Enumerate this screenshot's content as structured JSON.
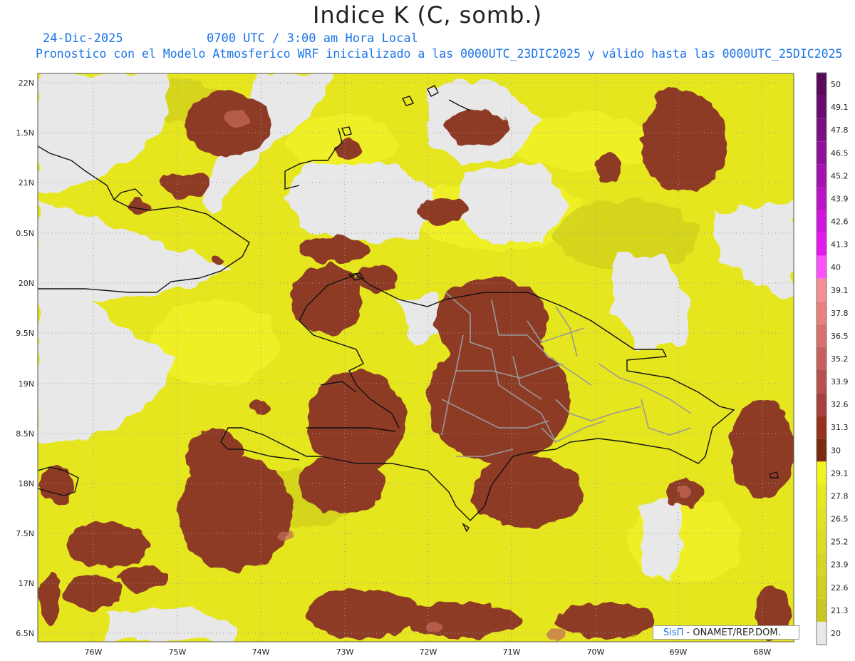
{
  "header": {
    "title": "Indice K (C, somb.)",
    "date": "24-Dic-2025",
    "time": "0700 UTC / 3:00 am Hora Local",
    "description": "Pronostico con el Modelo Atmosferico WRF inicializado a las 0000UTC_23DIC2025 y válido hasta las  0000UTC_25DIC2025"
  },
  "map": {
    "lat_labels": [
      "22N",
      "1.5N",
      "21N",
      "0.5N",
      "20N",
      "9.5N",
      "19N",
      "8.5N",
      "18N",
      "7.5N",
      "17N",
      "6.5N"
    ],
    "lon_labels": [
      "76W",
      "75W",
      "74W",
      "73W",
      "72W",
      "71W",
      "70W",
      "69W",
      "68W"
    ]
  },
  "colorbar": {
    "levels": [
      "50",
      "49.1",
      "47.8",
      "46.5",
      "45.2",
      "43.9",
      "42.6",
      "41.3",
      "40",
      "39.1",
      "37.8",
      "36.5",
      "35.2",
      "33.9",
      "32.6",
      "31.3",
      "30",
      "29.1",
      "27.8",
      "26.5",
      "25.2",
      "23.9",
      "22.6",
      "21.3",
      "20"
    ],
    "colors": [
      "#5a0a5a",
      "#6a0c6e",
      "#7c0e84",
      "#8e109a",
      "#a412b0",
      "#ba14c6",
      "#d016dc",
      "#e618f0",
      "#ff50ff",
      "#f49090",
      "#e88080",
      "#d87070",
      "#c86060",
      "#b85050",
      "#a84040",
      "#983020",
      "#7a2a12",
      "#f2f220",
      "#e8e820",
      "#e2e224",
      "#dcdc26",
      "#d6d624",
      "#d0d020",
      "#c8c81c",
      "#e8e8e8"
    ]
  },
  "colors": {
    "no_data": "#e8e8e8",
    "yellow": "#e6e61e",
    "brown": "#8e3a28",
    "coast": "#111111",
    "province": "#9a9a9a"
  },
  "credit": {
    "brand": "SisΠ",
    "org": " - ONAMET/REP.DOM."
  }
}
